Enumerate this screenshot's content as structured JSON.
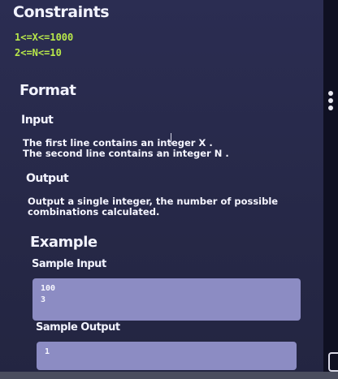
{
  "constraints": {
    "title": "Constraints",
    "lines": [
      "1<=X<=1000",
      "2<=N<=10"
    ]
  },
  "format": {
    "title": "Format",
    "input": {
      "title": "Input",
      "lines": [
        "The first line contains an integer X .",
        "The second line contains an integer N ."
      ]
    },
    "output": {
      "title": "Output",
      "text": "Output a single integer, the number of possible combinations calculated."
    }
  },
  "example": {
    "title": "Example",
    "sample_input_label": "Sample Input",
    "sample_input_lines": [
      "100",
      "3"
    ],
    "sample_output_label": "Sample Output",
    "sample_output_lines": [
      "1"
    ]
  },
  "icons": {
    "menu": "more-vertical-icon",
    "cursor": "text-cursor-icon"
  },
  "colors": {
    "panel": "#2b2d52",
    "accent_code": "#b8e84a",
    "codebox": "#8c8cc3"
  }
}
